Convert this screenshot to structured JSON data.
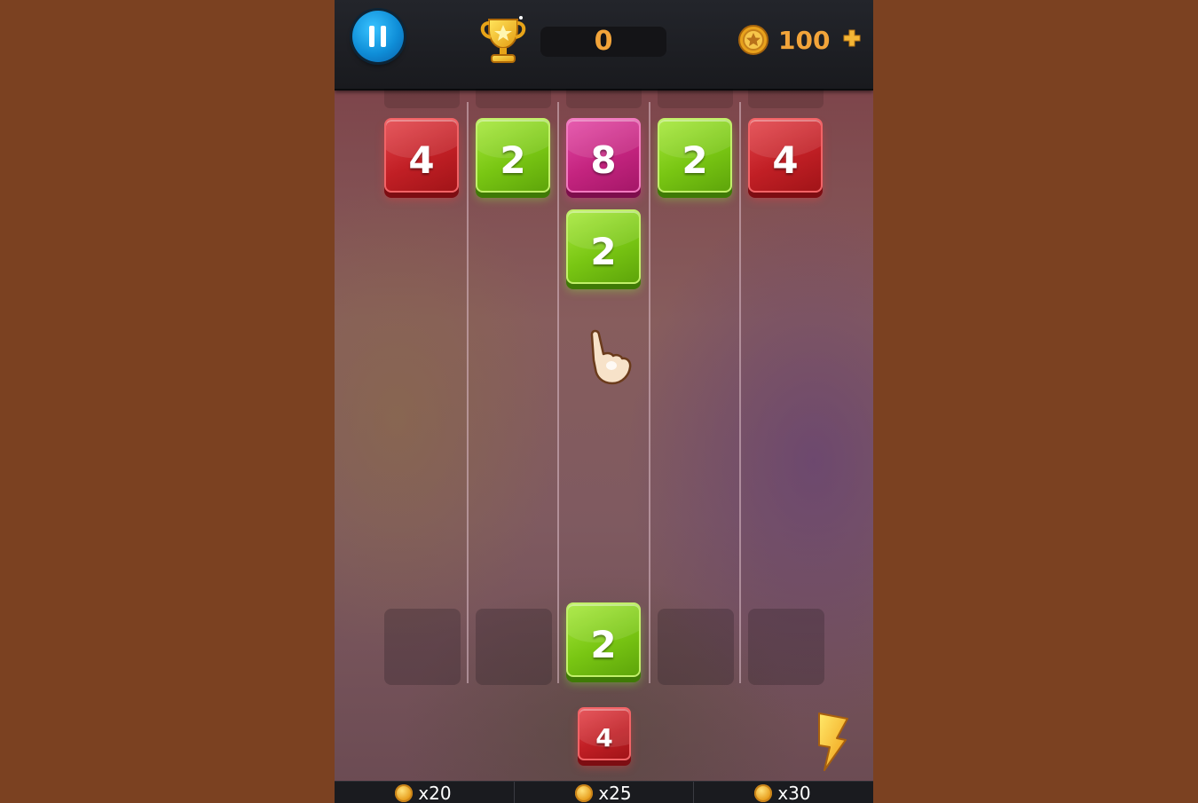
{
  "hud": {
    "score": "0",
    "coins": "100"
  },
  "icons": {
    "pause": "pause-icon",
    "trophy": "trophy-icon",
    "coin": "coin-icon",
    "add": "plus-icon",
    "hand": "pointing-hand-icon",
    "bolt": "lightning-bolt-icon"
  },
  "colors": {
    "tile_2": "#7cc51a",
    "tile_4": "#c42026",
    "tile_8": "#c4267f",
    "score_text": "#f2a43a",
    "background": "#7b4121"
  },
  "board": {
    "columns": 5,
    "top_row": [
      "4",
      "2",
      "8",
      "2",
      "4"
    ],
    "column_3_second": "2",
    "launch_row": [
      "",
      "",
      "2",
      "",
      ""
    ]
  },
  "next_tile": "4",
  "shop": [
    {
      "price": "x20"
    },
    {
      "price": "x25"
    },
    {
      "price": "x30"
    }
  ]
}
